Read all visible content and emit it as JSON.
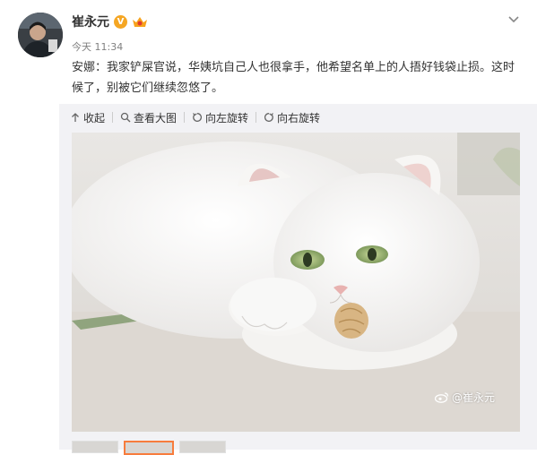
{
  "post": {
    "user": {
      "name": "崔永元",
      "verified_badge": "V",
      "avatar_icon": "user-avatar-icon"
    },
    "time": "今天 11:34",
    "text": "安娜：我家铲屎官说，华姨坑自己人也很拿手，他希望名单上的人捂好钱袋止损。这时候了，别被它们继续忽悠了。"
  },
  "toolbar": {
    "collapse": "收起",
    "view_large": "查看大图",
    "rotate_left": "向左旋转",
    "rotate_right": "向右旋转"
  },
  "image": {
    "subject": "white cat with green eyes and a walnut",
    "watermark": "@崔永元"
  },
  "thumbnails": {
    "count": 3,
    "active_index": 1
  },
  "colors": {
    "accent": "#f77c3d",
    "verified": "#f5a623",
    "text": "#333333",
    "muted": "#808080",
    "panel": "#f2f2f5"
  }
}
